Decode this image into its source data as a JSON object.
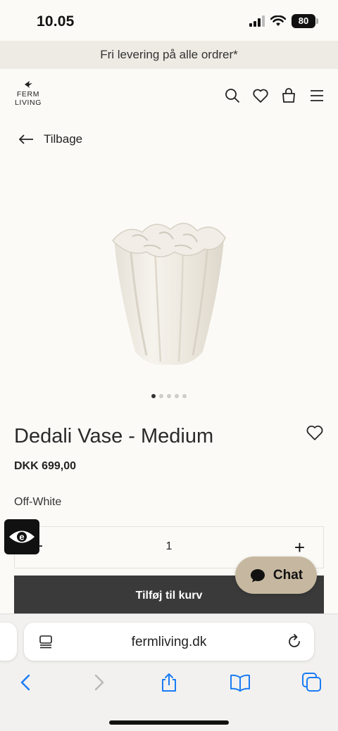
{
  "status_bar": {
    "time": "10.05",
    "battery": "80"
  },
  "promo": {
    "text": "Fri levering på alle ordrer*"
  },
  "header": {
    "logo_line1": "FERM",
    "logo_line2": "LIVING",
    "icons": [
      "search-icon",
      "heart-icon",
      "bag-icon",
      "menu-icon"
    ]
  },
  "nav": {
    "back_label": "Tilbage"
  },
  "product": {
    "title": "Dedali Vase - Medium",
    "price": "DKK 699,00",
    "color": "Off-White",
    "quantity": "1",
    "image_count": 5,
    "active_image": 1,
    "add_to_cart_label": "Tilføj til kurv"
  },
  "chat": {
    "label": "Chat"
  },
  "browser": {
    "url": "fermliving.dk"
  },
  "colors": {
    "page_bg": "#fbfaf6",
    "promo_bg": "#eeebe4",
    "button_bg": "#3a3a3a",
    "chat_bg": "#c6b8a0",
    "ios_blue": "#1a7cf5"
  }
}
